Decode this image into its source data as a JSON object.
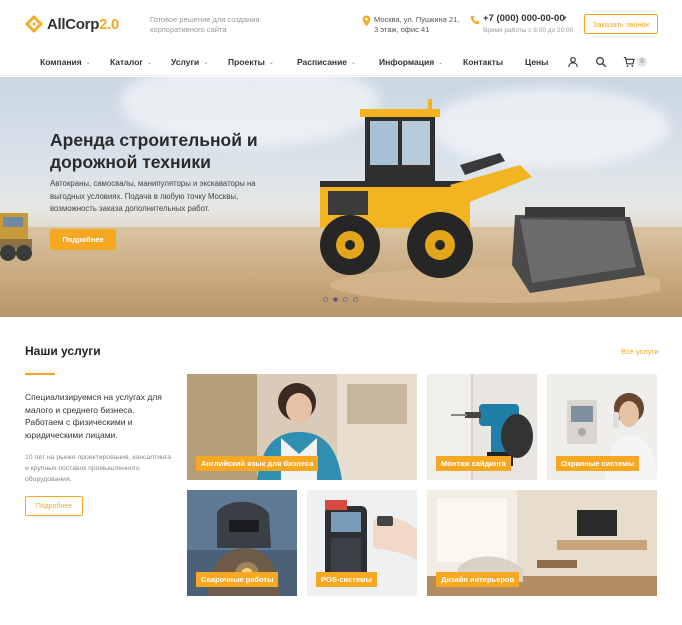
{
  "header": {
    "logo_name": "AllCorp",
    "logo_version": "2.0",
    "tagline": "Готовое решение для создания корпоративного сайта",
    "address": "Москва, ул. Пушкина 21, 3 этаж, офис 41",
    "phone": "+7 (000) 000-00-00",
    "worktime": "Время работы с 8:00 до 20:00",
    "callback_label": "Заказать звонок"
  },
  "nav": {
    "items": [
      {
        "label": "Компания",
        "dropdown": true
      },
      {
        "label": "Каталог",
        "dropdown": true
      },
      {
        "label": "Услуги",
        "dropdown": true
      },
      {
        "label": "Проекты",
        "dropdown": true
      },
      {
        "label": "Расписание",
        "dropdown": true
      },
      {
        "label": "Информация",
        "dropdown": true
      },
      {
        "label": "Контакты",
        "dropdown": false
      },
      {
        "label": "Цены",
        "dropdown": false
      }
    ],
    "cart_count": "0",
    "icons": [
      "user-icon",
      "search-icon",
      "cart-icon"
    ]
  },
  "hero": {
    "title": "Аренда строительной и дорожной техники",
    "text": "Автокраны, самосвалы, манипуляторы и экскаваторы на выгодных условиях. Подача в любую точку Москвы, возможность заказа дополнительных работ.",
    "button": "Подробнее",
    "slides_total": 4,
    "slide_active": 2
  },
  "services": {
    "title": "Наши услуги",
    "all_link": "Все услуги",
    "intro": "Специализируемся на услугах для малого и среднего бизнеса. Работаем с физическими и юридическими лицами.",
    "sub": "10 лет на рынке проектирования, консалтинга и крупных поставок промышленного оборудования.",
    "button": "Подробнее",
    "tiles": [
      {
        "label": "Английский язык для бизнеса"
      },
      {
        "label": "Монтаж сайдинга"
      },
      {
        "label": "Охранные системы"
      },
      {
        "label": "Сварочные работы"
      },
      {
        "label": "POS-системы"
      },
      {
        "label": "Дизайн интерьеров"
      }
    ]
  },
  "colors": {
    "accent": "#f7a823",
    "text": "#333333",
    "muted": "#999999"
  }
}
